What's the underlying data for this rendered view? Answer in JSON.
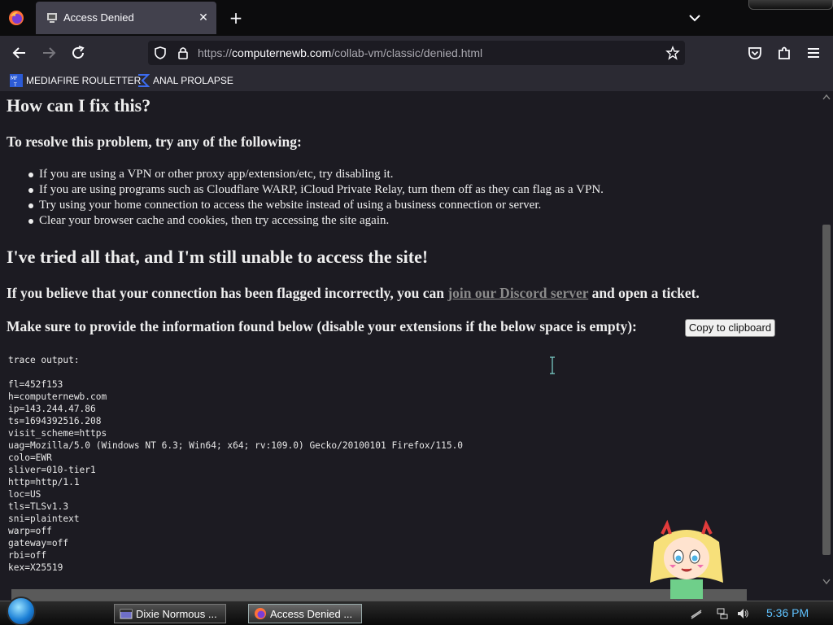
{
  "tab": {
    "title": "Access Denied"
  },
  "address": {
    "scheme": "https://",
    "host": "computernewb.com",
    "path": "/collab-vm/classic/denied.html"
  },
  "bookmarks": [
    {
      "label": "MEDIAFIRE ROULETTER",
      "icon": "mediafire-icon"
    },
    {
      "label": "ANAL PROLAPSE",
      "icon": "sigma-icon"
    }
  ],
  "content": {
    "fix_heading": "How can I fix this?",
    "resolve_heading": "To resolve this problem, try any of the following:",
    "tips": [
      "If you are using a VPN or other proxy app/extension/etc, try disabling it.",
      "If you are using programs such as Cloudflare WARP, iCloud Private Relay, turn them off as they can flag as a VPN.",
      "Try using your home connection to access the website instead of using a business connection or server.",
      "Clear your browser cache and cookies, then try accessing the site again."
    ],
    "tried_heading": "I've tried all that, and I'm still unable to access the site!",
    "flagged_pre": "If you believe that your connection has been flagged incorrectly, you can ",
    "flagged_link": "join our Discord server",
    "flagged_post": " and open a ticket.",
    "provide_info": "Make sure to provide the information found below (disable your extensions if the below space is empty):",
    "copy_button": "Copy to clipboard",
    "trace": "trace output:\n\nfl=452f153\nh=computernewb.com\nip=143.244.47.86\nts=1694392516.208\nvisit_scheme=https\nuag=Mozilla/5.0 (Windows NT 6.3; Win64; x64; rv:109.0) Gecko/20100101 Firefox/115.0\ncolo=EWR\nsliver=010-tier1\nhttp=http/1.1\nloc=US\ntls=TLSv1.3\nsni=plaintext\nwarp=off\ngateway=off\nrbi=off\nkex=X25519"
  },
  "taskbar": {
    "tasks": [
      {
        "label": "Dixie Normous ...",
        "icon": "window-icon"
      },
      {
        "label": "Access Denied ...",
        "icon": "firefox-icon"
      }
    ],
    "clock": "5:36 PM"
  },
  "colors": {
    "page_bg": "#1c1b22",
    "toolbar_bg": "#2b2a33",
    "clock": "#5fc2ff",
    "link": "#8a8a8a"
  }
}
